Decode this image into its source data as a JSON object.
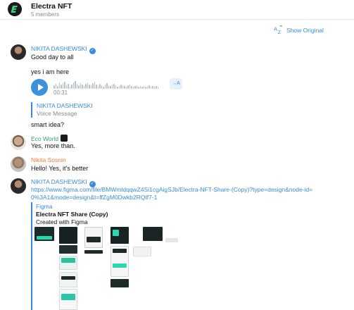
{
  "header": {
    "title": "Electra NFT",
    "subtitle": "5 members",
    "logo_icon": "electra-logo"
  },
  "toolbar": {
    "translate_label": "Show Original",
    "translate_icon": "translate-icon"
  },
  "messages": [
    {
      "sender": "NIKITA DASHEWSKI",
      "verified": true,
      "lines": [
        "Good day to all",
        "yes i am here"
      ]
    },
    {
      "type": "voice",
      "duration": "00:31",
      "transcribe_label": "→A"
    },
    {
      "reply": {
        "name": "NIKITA DASHEWSKI",
        "text": "Voice Message"
      },
      "text": "smart idea?"
    },
    {
      "sender": "Eco World",
      "text": "Yes, more than."
    },
    {
      "sender": "Nikita Sosnin",
      "text": "Hello! Yes, it's better"
    },
    {
      "sender": "NIKITA DASHEWSKI",
      "verified": true,
      "link": "https://www.figma.com/file/BMWmldqqwZ4Si1cgAigSJb/Electra-NFT-Share-(Copy)?type=design&node-id=0%3A1&mode=design&t=ffZgM0Dwkb2RQtf7-1",
      "preview": {
        "site": "Figma",
        "title": "Electra NFT Share (Copy)",
        "description": "Created with Figma"
      }
    }
  ],
  "colors": {
    "accent": "#3a8bd6",
    "eco_world_name": "#38a068",
    "sosnin_name": "#e57d3a"
  }
}
